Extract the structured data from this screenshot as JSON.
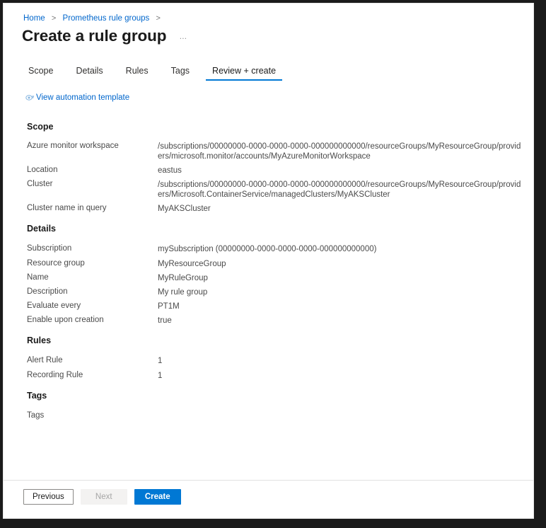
{
  "breadcrumb": {
    "items": [
      {
        "label": "Home"
      },
      {
        "label": "Prometheus rule groups"
      }
    ],
    "separator": ">"
  },
  "header": {
    "title": "Create a rule group",
    "more_menu": "…"
  },
  "tabs": [
    {
      "label": "Scope",
      "active": false
    },
    {
      "label": "Details",
      "active": false
    },
    {
      "label": "Rules",
      "active": false
    },
    {
      "label": "Tags",
      "active": false
    },
    {
      "label": "Review + create",
      "active": true
    }
  ],
  "automation_link": {
    "label": "View automation template",
    "icon": "eye-icon"
  },
  "sections": [
    {
      "heading": "Scope",
      "rows": [
        {
          "label": "Azure monitor workspace",
          "value": "/subscriptions/00000000-0000-0000-0000-000000000000/resourceGroups/MyResourceGroup/providers/microsoft.monitor/accounts/MyAzureMonitorWorkspace"
        },
        {
          "label": "Location",
          "value": "eastus"
        },
        {
          "label": "Cluster",
          "value": "/subscriptions/00000000-0000-0000-0000-000000000000/resourceGroups/MyResourceGroup/providers/Microsoft.ContainerService/managedClusters/MyAKSCluster"
        },
        {
          "label": "Cluster name in query",
          "value": "MyAKSCluster"
        }
      ]
    },
    {
      "heading": "Details",
      "rows": [
        {
          "label": "Subscription",
          "value": "mySubscription (00000000-0000-0000-0000-000000000000)"
        },
        {
          "label": "Resource group",
          "value": "MyResourceGroup"
        },
        {
          "label": "Name",
          "value": "MyRuleGroup"
        },
        {
          "label": "Description",
          "value": "My rule group"
        },
        {
          "label": "Evaluate every",
          "value": "PT1M"
        },
        {
          "label": "Enable upon creation",
          "value": "true"
        }
      ]
    },
    {
      "heading": "Rules",
      "rows": [
        {
          "label": "Alert Rule",
          "value": "1"
        },
        {
          "label": "Recording Rule",
          "value": "1"
        }
      ]
    },
    {
      "heading": "Tags",
      "rows": [
        {
          "label": "Tags",
          "value": ""
        }
      ]
    }
  ],
  "footer": {
    "previous_label": "Previous",
    "next_label": "Next",
    "create_label": "Create"
  },
  "colors": {
    "accent": "#0078d4",
    "link": "#0066cc",
    "text": "#1a1a1a",
    "muted": "#4a4a4a"
  }
}
